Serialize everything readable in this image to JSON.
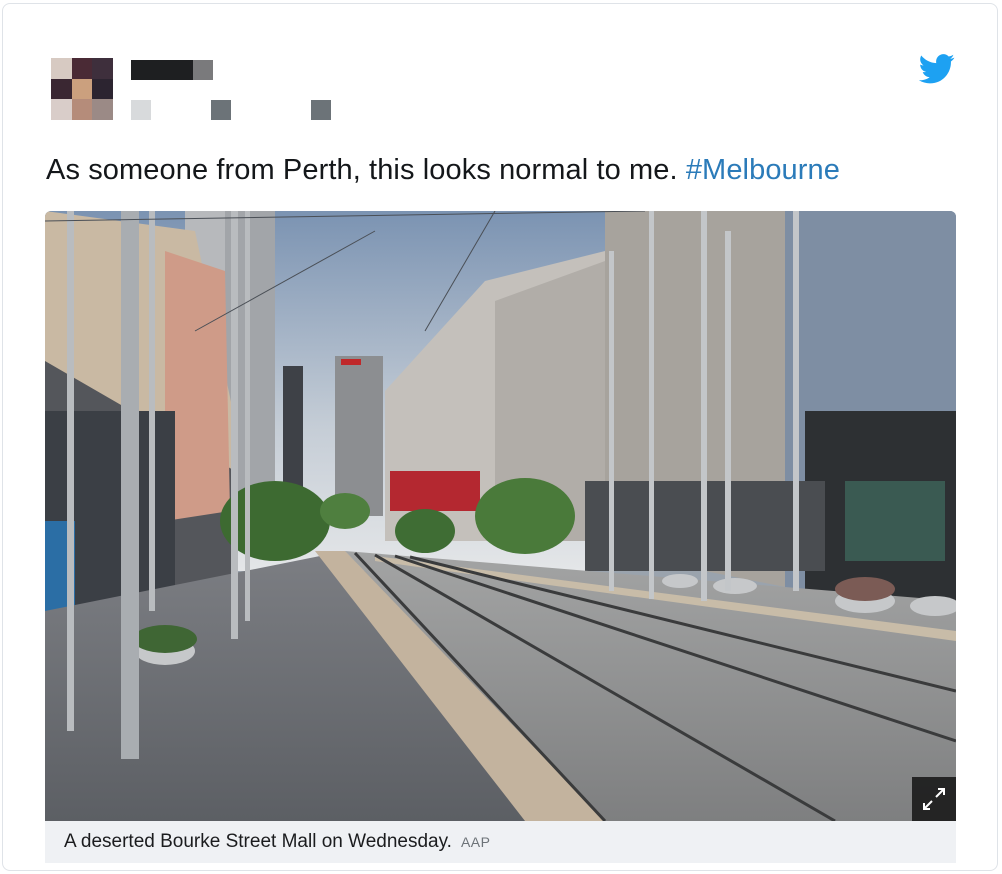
{
  "tweet": {
    "text": "As someone from Perth, this looks normal to me. ",
    "hashtag": "#Melbourne",
    "icon": "twitter-bird-icon"
  },
  "media": {
    "caption": "A deserted Bourke Street Mall on Wednesday.",
    "credit": "AAP",
    "expand_icon": "expand-icon"
  },
  "colors": {
    "twitter_blue": "#1da1f2",
    "hashtag": "#2b7bb9",
    "caption_bg": "#eff1f4"
  }
}
